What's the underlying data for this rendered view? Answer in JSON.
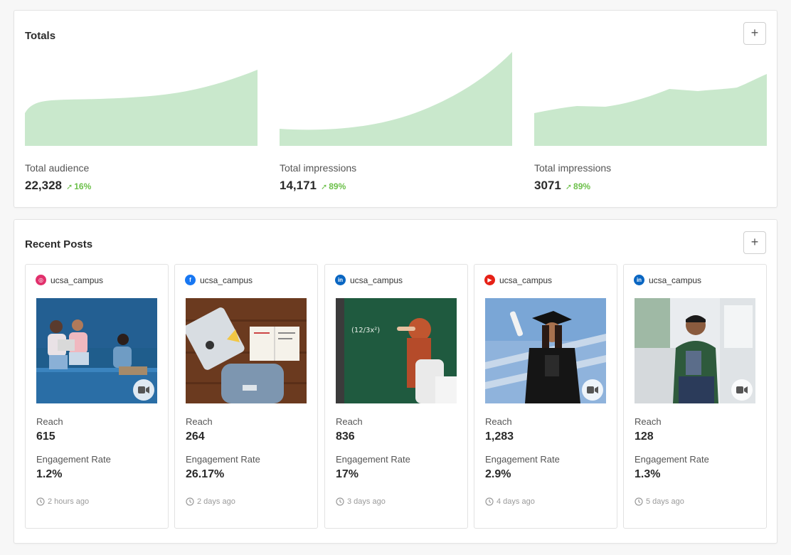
{
  "totals": {
    "title": "Totals",
    "add_label": "+",
    "metrics": [
      {
        "label": "Total audience",
        "value": "22,328",
        "change": "16%"
      },
      {
        "label": "Total impressions",
        "value": "14,171",
        "change": "89%"
      },
      {
        "label": "Total impressions",
        "value": "3071",
        "change": "89%"
      }
    ]
  },
  "recent": {
    "title": "Recent Posts",
    "add_label": "+",
    "reach_label": "Reach",
    "engagement_label": "Engagement Rate",
    "posts": [
      {
        "network": "instagram",
        "user": "ucsa_campus",
        "reach": "615",
        "engagement": "1.2%",
        "time": "2 hours ago",
        "video": true
      },
      {
        "network": "facebook",
        "user": "ucsa_campus",
        "reach": "264",
        "engagement": "26.17%",
        "time": "2 days ago",
        "video": false
      },
      {
        "network": "linkedin",
        "user": "ucsa_campus",
        "reach": "836",
        "engagement": "17%",
        "time": "3 days ago",
        "video": false
      },
      {
        "network": "youtube",
        "user": "ucsa_campus",
        "reach": "1,283",
        "engagement": "2.9%",
        "time": "4 days ago",
        "video": true
      },
      {
        "network": "linkedin",
        "user": "ucsa_campus",
        "reach": "128",
        "engagement": "1.3%",
        "time": "5 days ago",
        "video": true
      }
    ]
  },
  "colors": {
    "area_fill": "#c9e8cc",
    "positive": "#6cc04a",
    "instagram": "#e1306c",
    "facebook": "#1877f2",
    "linkedin": "#0a66c2",
    "youtube": "#e62117"
  }
}
